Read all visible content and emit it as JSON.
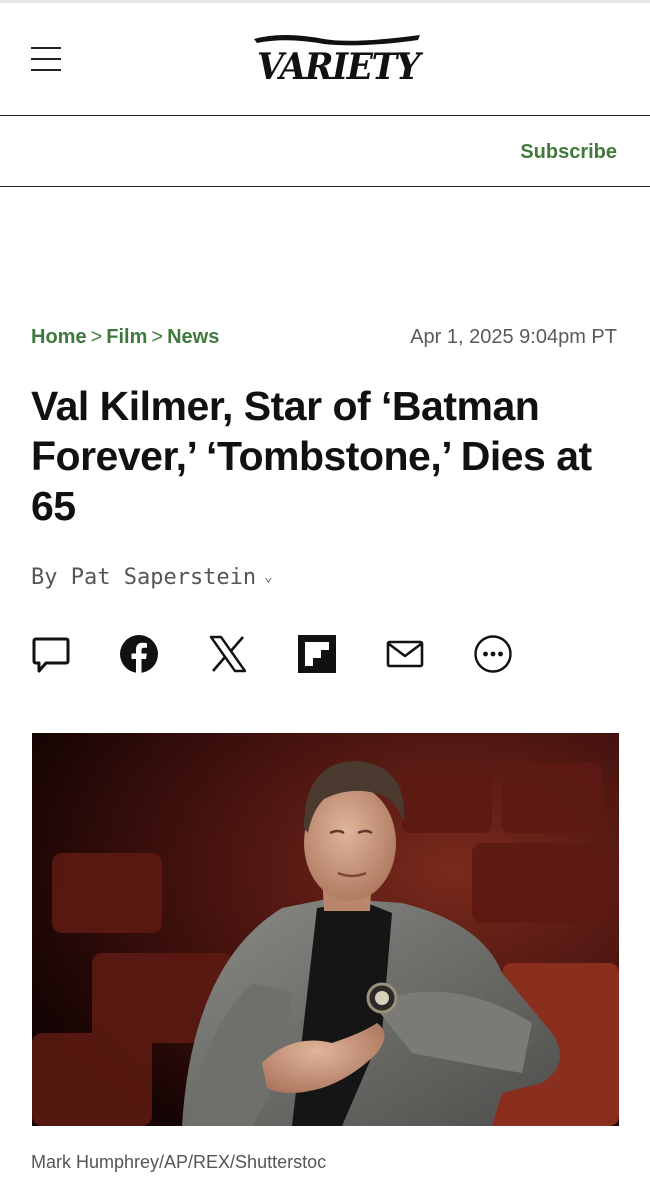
{
  "header": {
    "menu_icon": "hamburger-menu-icon",
    "logo_text": "VARIETY"
  },
  "subbar": {
    "subscribe_label": "Subscribe"
  },
  "breadcrumb": {
    "items": [
      "Home",
      "Film",
      "News"
    ],
    "separator": ">"
  },
  "article": {
    "timestamp": "Apr 1, 2025 9:04pm PT",
    "title": "Val Kilmer, Star of ‘Batman Forever,’ ‘Tombstone,’ Dies at 65",
    "byline": "By Pat Saperstein",
    "byline_icon": "chevron-down-icon",
    "image_caption": "Mark Humphrey/AP/REX/Shutterstoc"
  },
  "share_icons": [
    "comment-icon",
    "facebook-icon",
    "x-icon",
    "flipboard-icon",
    "email-icon",
    "more-icon"
  ],
  "colors": {
    "accent_green": "#3f7a3c",
    "text": "#111111",
    "muted": "#555555",
    "divider": "#222222"
  }
}
